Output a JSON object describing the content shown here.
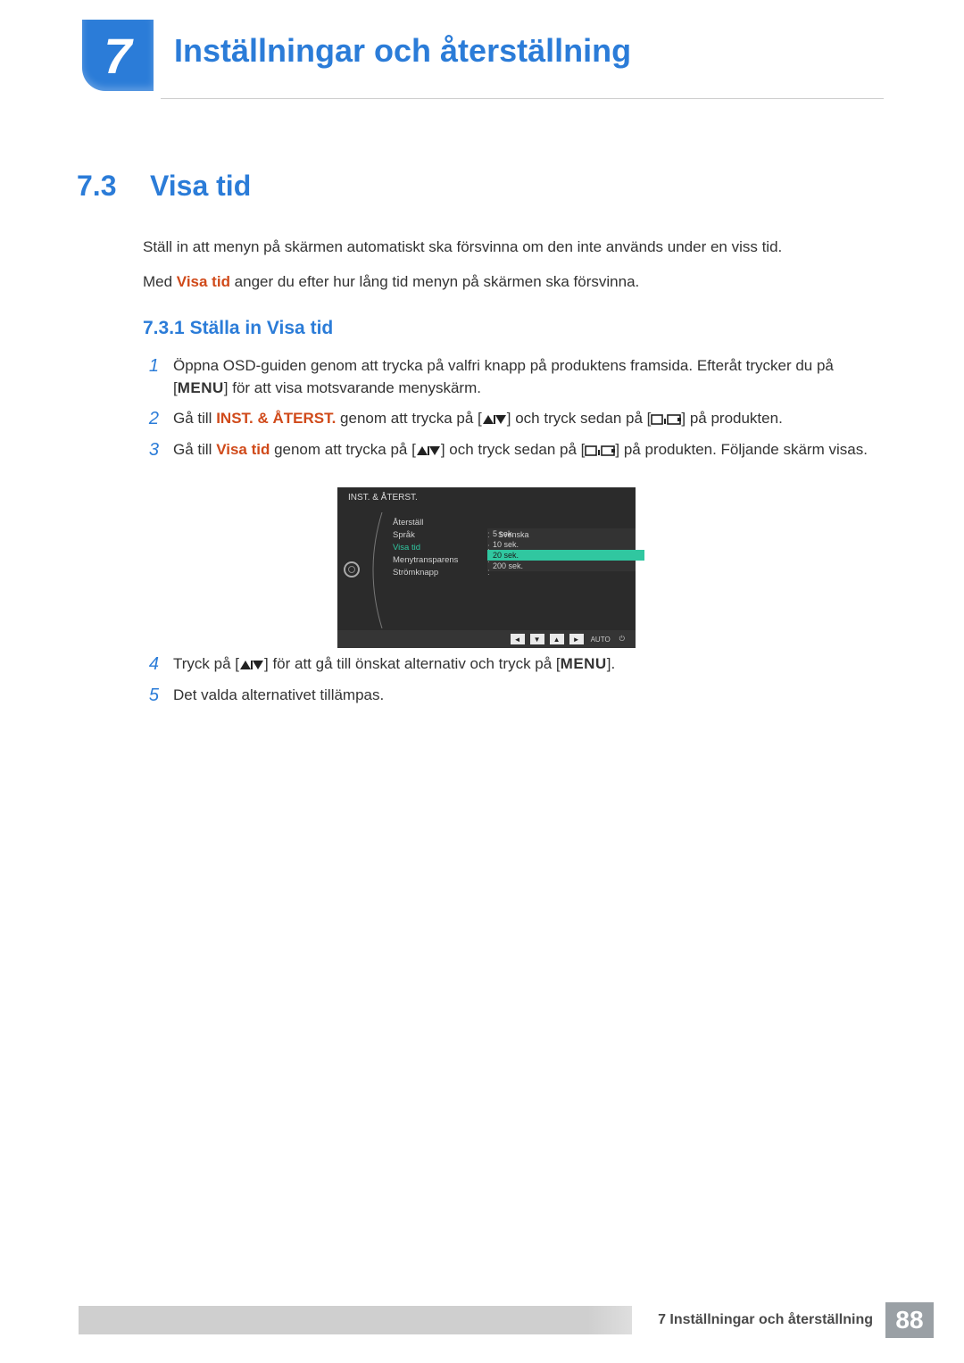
{
  "chapter": {
    "number": "7",
    "title": "Inställningar och återställning"
  },
  "section": {
    "number": "7.3",
    "title": "Visa tid"
  },
  "intro": {
    "p1": "Ställ in att menyn på skärmen automatiskt ska försvinna om den inte används under en viss tid.",
    "p2a": "Med ",
    "p2kw": "Visa tid",
    "p2b": " anger du efter hur lång tid menyn på skärmen ska försvinna."
  },
  "subsection": {
    "number": "7.3.1",
    "title": "Ställa in Visa tid"
  },
  "menu_label": "MENU",
  "steps": {
    "s1": {
      "num": "1",
      "a": "Öppna OSD-guiden genom att trycka på valfri knapp på produktens framsida. Efteråt trycker du på [",
      "b": "] för att visa motsvarande menyskärm."
    },
    "s2": {
      "num": "2",
      "a": "Gå till ",
      "kw": "INST. & ÅTERST.",
      "b": " genom att trycka på [",
      "c": "] och tryck sedan på [",
      "d": "] på produkten."
    },
    "s3": {
      "num": "3",
      "a": "Gå till ",
      "kw": "Visa tid",
      "b": " genom att trycka på [",
      "c": "] och tryck sedan på [",
      "d": "] på produkten. Följande skärm visas."
    },
    "s4": {
      "num": "4",
      "a": "Tryck på [",
      "b": "] för att gå till önskat alternativ och tryck på [",
      "c": "]."
    },
    "s5": {
      "num": "5",
      "a": "Det valda alternativet tillämpas."
    }
  },
  "osd": {
    "title": "INST. & ÅTERST.",
    "rows": {
      "reset": "Återställ",
      "lang_label": "Språk",
      "lang_value": "Svenska",
      "disp_label": "Visa tid",
      "trans_label": "Menytransparens",
      "power_label": "Strömknapp"
    },
    "options": {
      "o1": "5 sek.",
      "o2": "10 sek.",
      "o3": "20 sek.",
      "o4": "200 sek."
    },
    "footer": {
      "auto": "AUTO"
    }
  },
  "footer": {
    "crumb": "7 Inställningar och återställning",
    "page": "88"
  }
}
